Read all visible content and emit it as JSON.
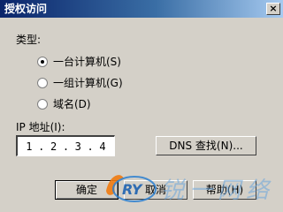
{
  "window": {
    "title": "授权访问",
    "close_glyph": "×"
  },
  "type_label": "类型:",
  "radios": [
    {
      "label": "一台计算机(S)",
      "checked": true
    },
    {
      "label": "一组计算机(G)",
      "checked": false
    },
    {
      "label": "域名(D)",
      "checked": false
    }
  ],
  "ip": {
    "label": "IP 地址(I):",
    "octets": [
      "1",
      "2",
      "3",
      "4"
    ],
    "separator": "."
  },
  "buttons": {
    "dns_lookup": "DNS 查找(N)...",
    "ok": "确定",
    "cancel": "取消",
    "help": "帮助(H)"
  },
  "watermark": {
    "logo_text": "RY",
    "text": "锐一网络"
  }
}
